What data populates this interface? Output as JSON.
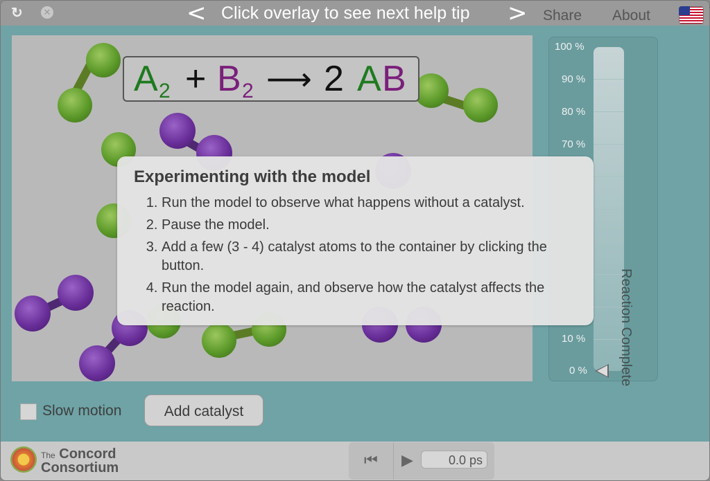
{
  "topbar": {
    "reload_icon": "reload-icon",
    "close_icon": "close-icon",
    "help_prev": "<",
    "help_text": "Click overlay to see next help tip",
    "help_next": ">",
    "share": "Share",
    "about": "About",
    "language_flag": "us-flag-icon"
  },
  "equation": {
    "a": "A",
    "a_sub": "2",
    "plus": "+",
    "b": "B",
    "b_sub": "2",
    "arrow": "⟶",
    "coef": "2",
    "prod_a": "A",
    "prod_b": "B"
  },
  "reaction_panel": {
    "label": "Reaction Complete",
    "ticks": [
      "100 %",
      "90 %",
      "80 %",
      "70 %",
      "10 %",
      "0 %"
    ],
    "progress_percent": 0
  },
  "overlay": {
    "title": "Experimenting with the model",
    "steps": [
      "Run the model to observe what happens without a catalyst.",
      "Pause the model.",
      "Add a few (3 - 4) catalyst atoms to the container by clicking the button.",
      "Run the model again, and observe how the catalyst affects the reaction."
    ]
  },
  "controls": {
    "slow_motion_label": "Slow motion",
    "slow_motion_checked": false,
    "add_catalyst": "Add catalyst"
  },
  "footer": {
    "logo_small": "The",
    "logo_line1": "Concord",
    "logo_line2": "Consortium",
    "reset_icon": "reset-icon",
    "play_icon": "play-icon",
    "time": "0.0 ps"
  },
  "colors": {
    "species_a": "#1f7a1f",
    "species_b": "#7a1f7a",
    "background": "#6fa3a6"
  }
}
